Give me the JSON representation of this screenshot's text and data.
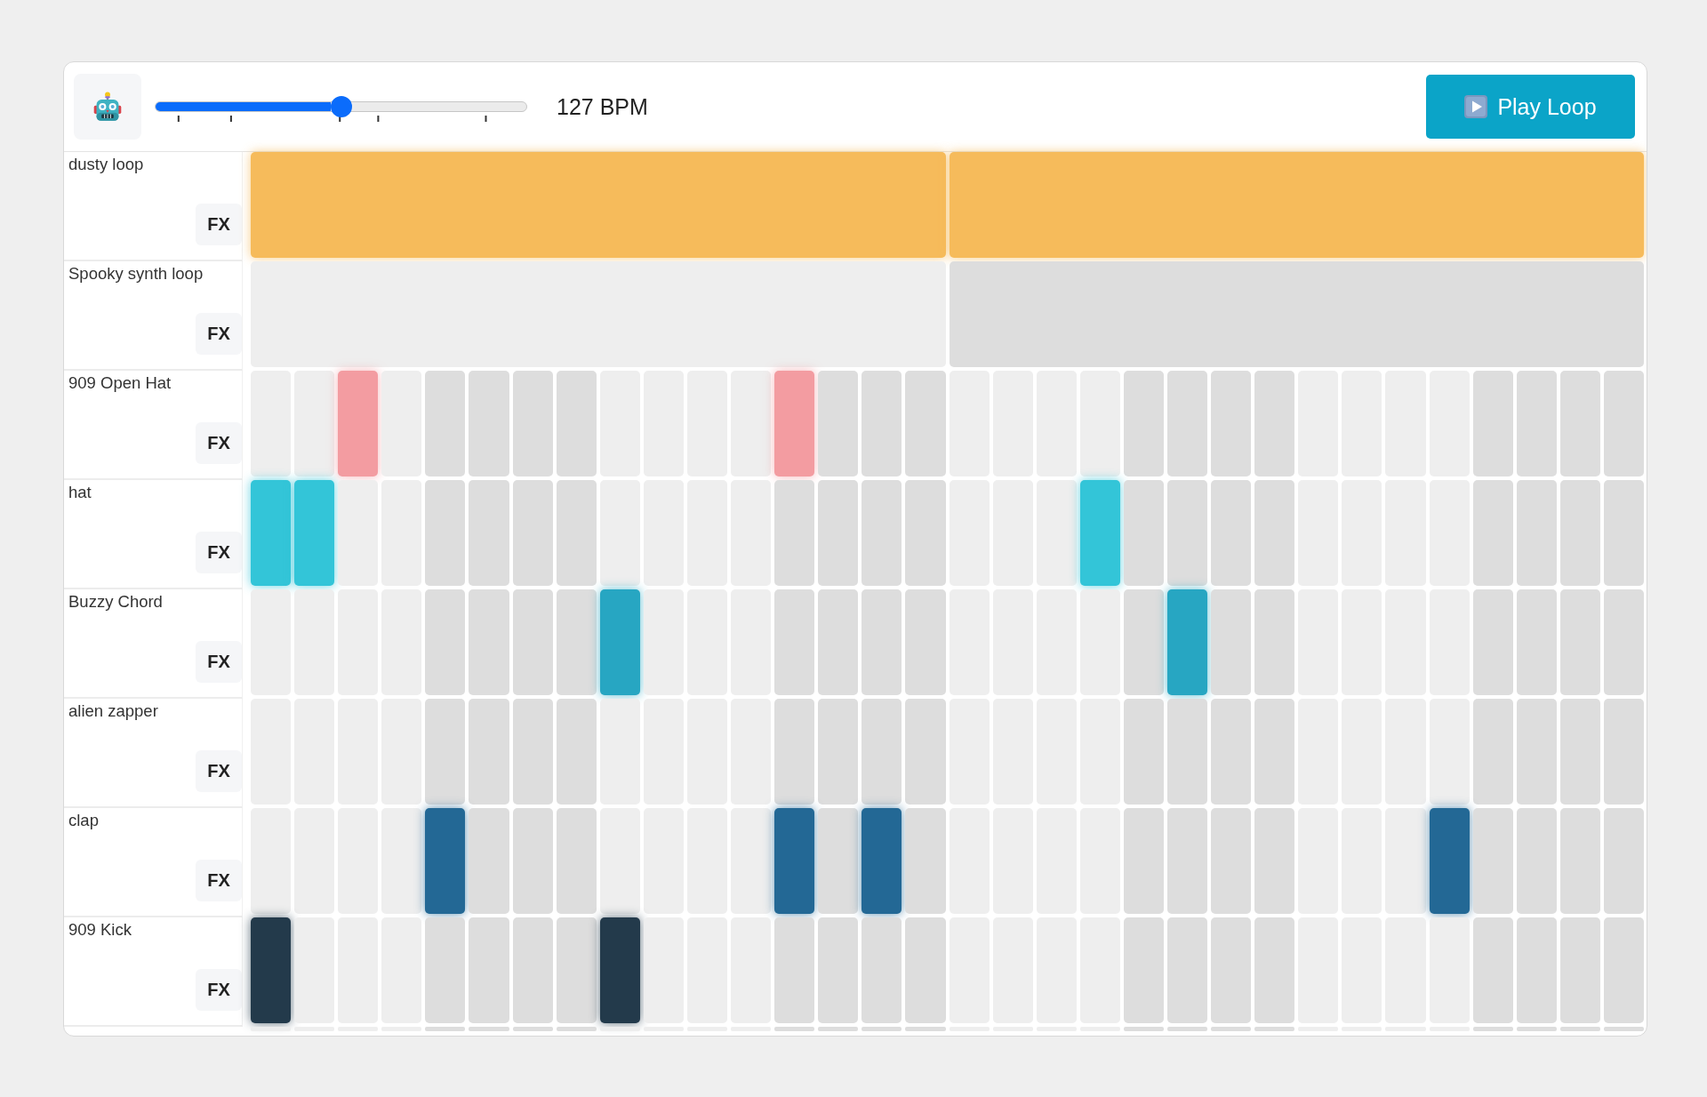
{
  "toolbar": {
    "tempo_slider": {
      "level": 0.5
    },
    "tempo_reading": "127 BPM",
    "play_button": {
      "label": "Play Loop"
    }
  },
  "tracks": [
    {
      "name": "dusty loop",
      "kind": "loop",
      "color": "#f6bb5b",
      "fx": "FX",
      "segments": [
        {
          "on": true
        },
        {
          "on": true
        }
      ]
    },
    {
      "name": "Spooky synth loop",
      "kind": "loop",
      "fx": "FX",
      "segments": [
        {
          "on": false
        },
        {
          "on": false
        }
      ]
    },
    {
      "name": "909 Open Hat",
      "kind": "steps",
      "color": "#f39ca1",
      "fx": "FX",
      "steps": [
        {
          "on": false
        },
        {
          "on": false
        },
        {
          "on": true
        },
        {
          "on": false
        },
        {
          "on": false
        },
        {
          "on": false
        },
        {
          "on": false
        },
        {
          "on": false
        },
        {
          "on": false
        },
        {
          "on": false
        },
        {
          "on": false
        },
        {
          "on": false
        },
        {
          "on": true
        },
        {
          "on": false
        },
        {
          "on": false
        },
        {
          "on": false
        },
        {
          "on": false
        },
        {
          "on": false
        },
        {
          "on": false
        },
        {
          "on": false
        },
        {
          "on": false
        },
        {
          "on": false
        },
        {
          "on": false
        },
        {
          "on": false
        },
        {
          "on": false
        },
        {
          "on": false
        },
        {
          "on": false
        },
        {
          "on": false
        },
        {
          "on": false
        },
        {
          "on": false
        },
        {
          "on": false
        },
        {
          "on": false
        }
      ]
    },
    {
      "name": "hat",
      "kind": "steps",
      "color": "#33c5d8",
      "fx": "FX",
      "steps": [
        {
          "on": true
        },
        {
          "on": true
        },
        {
          "on": false
        },
        {
          "on": false
        },
        {
          "on": false
        },
        {
          "on": false
        },
        {
          "on": false
        },
        {
          "on": false
        },
        {
          "on": false
        },
        {
          "on": false
        },
        {
          "on": false
        },
        {
          "on": false
        },
        {
          "on": false
        },
        {
          "on": false
        },
        {
          "on": false
        },
        {
          "on": false
        },
        {
          "on": false
        },
        {
          "on": false
        },
        {
          "on": false
        },
        {
          "on": true
        },
        {
          "on": false
        },
        {
          "on": false
        },
        {
          "on": false
        },
        {
          "on": false
        },
        {
          "on": false
        },
        {
          "on": false
        },
        {
          "on": false
        },
        {
          "on": false
        },
        {
          "on": false
        },
        {
          "on": false
        },
        {
          "on": false
        },
        {
          "on": false
        }
      ]
    },
    {
      "name": "Buzzy Chord",
      "kind": "steps",
      "color": "#27a6c2",
      "fx": "FX",
      "steps": [
        {
          "on": false
        },
        {
          "on": false
        },
        {
          "on": false
        },
        {
          "on": false
        },
        {
          "on": false
        },
        {
          "on": false
        },
        {
          "on": false
        },
        {
          "on": false
        },
        {
          "on": true
        },
        {
          "on": false
        },
        {
          "on": false
        },
        {
          "on": false
        },
        {
          "on": false
        },
        {
          "on": false
        },
        {
          "on": false
        },
        {
          "on": false
        },
        {
          "on": false
        },
        {
          "on": false
        },
        {
          "on": false
        },
        {
          "on": false
        },
        {
          "on": false
        },
        {
          "on": true
        },
        {
          "on": false
        },
        {
          "on": false
        },
        {
          "on": false
        },
        {
          "on": false
        },
        {
          "on": false
        },
        {
          "on": false
        },
        {
          "on": false
        },
        {
          "on": false
        },
        {
          "on": false
        },
        {
          "on": false
        }
      ]
    },
    {
      "name": "alien zapper",
      "kind": "steps",
      "fx": "FX",
      "steps": [
        {
          "on": false
        },
        {
          "on": false
        },
        {
          "on": false
        },
        {
          "on": false
        },
        {
          "on": false
        },
        {
          "on": false
        },
        {
          "on": false
        },
        {
          "on": false
        },
        {
          "on": false
        },
        {
          "on": false
        },
        {
          "on": false
        },
        {
          "on": false
        },
        {
          "on": false
        },
        {
          "on": false
        },
        {
          "on": false
        },
        {
          "on": false
        },
        {
          "on": false
        },
        {
          "on": false
        },
        {
          "on": false
        },
        {
          "on": false
        },
        {
          "on": false
        },
        {
          "on": false
        },
        {
          "on": false
        },
        {
          "on": false
        },
        {
          "on": false
        },
        {
          "on": false
        },
        {
          "on": false
        },
        {
          "on": false
        },
        {
          "on": false
        },
        {
          "on": false
        },
        {
          "on": false
        },
        {
          "on": false
        }
      ]
    },
    {
      "name": "clap",
      "kind": "steps",
      "color": "#236895",
      "fx": "FX",
      "steps": [
        {
          "on": false
        },
        {
          "on": false
        },
        {
          "on": false
        },
        {
          "on": false
        },
        {
          "on": true
        },
        {
          "on": false
        },
        {
          "on": false
        },
        {
          "on": false
        },
        {
          "on": false
        },
        {
          "on": false
        },
        {
          "on": false
        },
        {
          "on": false
        },
        {
          "on": true
        },
        {
          "on": false
        },
        {
          "on": true
        },
        {
          "on": false
        },
        {
          "on": false
        },
        {
          "on": false
        },
        {
          "on": false
        },
        {
          "on": false
        },
        {
          "on": false
        },
        {
          "on": false
        },
        {
          "on": false
        },
        {
          "on": false
        },
        {
          "on": false
        },
        {
          "on": false
        },
        {
          "on": false
        },
        {
          "on": true
        },
        {
          "on": false
        },
        {
          "on": false
        },
        {
          "on": false
        },
        {
          "on": false
        }
      ]
    },
    {
      "name": "909 Kick",
      "kind": "steps",
      "color": "#233a4b",
      "fx": "FX",
      "steps": [
        {
          "on": true
        },
        {
          "on": false
        },
        {
          "on": false
        },
        {
          "on": false
        },
        {
          "on": false
        },
        {
          "on": false
        },
        {
          "on": false
        },
        {
          "on": false
        },
        {
          "on": true
        },
        {
          "on": false
        },
        {
          "on": false
        },
        {
          "on": false
        },
        {
          "on": false
        },
        {
          "on": false
        },
        {
          "on": false
        },
        {
          "on": false
        },
        {
          "on": false
        },
        {
          "on": false
        },
        {
          "on": false
        },
        {
          "on": false
        },
        {
          "on": false
        },
        {
          "on": false
        },
        {
          "on": false
        },
        {
          "on": false
        },
        {
          "on": false
        },
        {
          "on": false
        },
        {
          "on": false
        },
        {
          "on": false
        },
        {
          "on": false
        },
        {
          "on": false
        },
        {
          "on": false
        },
        {
          "on": false
        }
      ]
    }
  ],
  "cut_off_row": {
    "steps": [
      {
        "on": false
      },
      {
        "on": false
      },
      {
        "on": false
      },
      {
        "on": false
      },
      {
        "on": false
      },
      {
        "on": false
      },
      {
        "on": false
      },
      {
        "on": false
      },
      {
        "on": false
      },
      {
        "on": false
      },
      {
        "on": false
      },
      {
        "on": false
      },
      {
        "on": false
      },
      {
        "on": false
      },
      {
        "on": false
      },
      {
        "on": false
      },
      {
        "on": false
      },
      {
        "on": false
      },
      {
        "on": false
      },
      {
        "on": false
      },
      {
        "on": false
      },
      {
        "on": false
      },
      {
        "on": false
      },
      {
        "on": false
      },
      {
        "on": false
      },
      {
        "on": false
      },
      {
        "on": false
      },
      {
        "on": false
      },
      {
        "on": false
      },
      {
        "on": false
      },
      {
        "on": false
      },
      {
        "on": false
      }
    ]
  }
}
